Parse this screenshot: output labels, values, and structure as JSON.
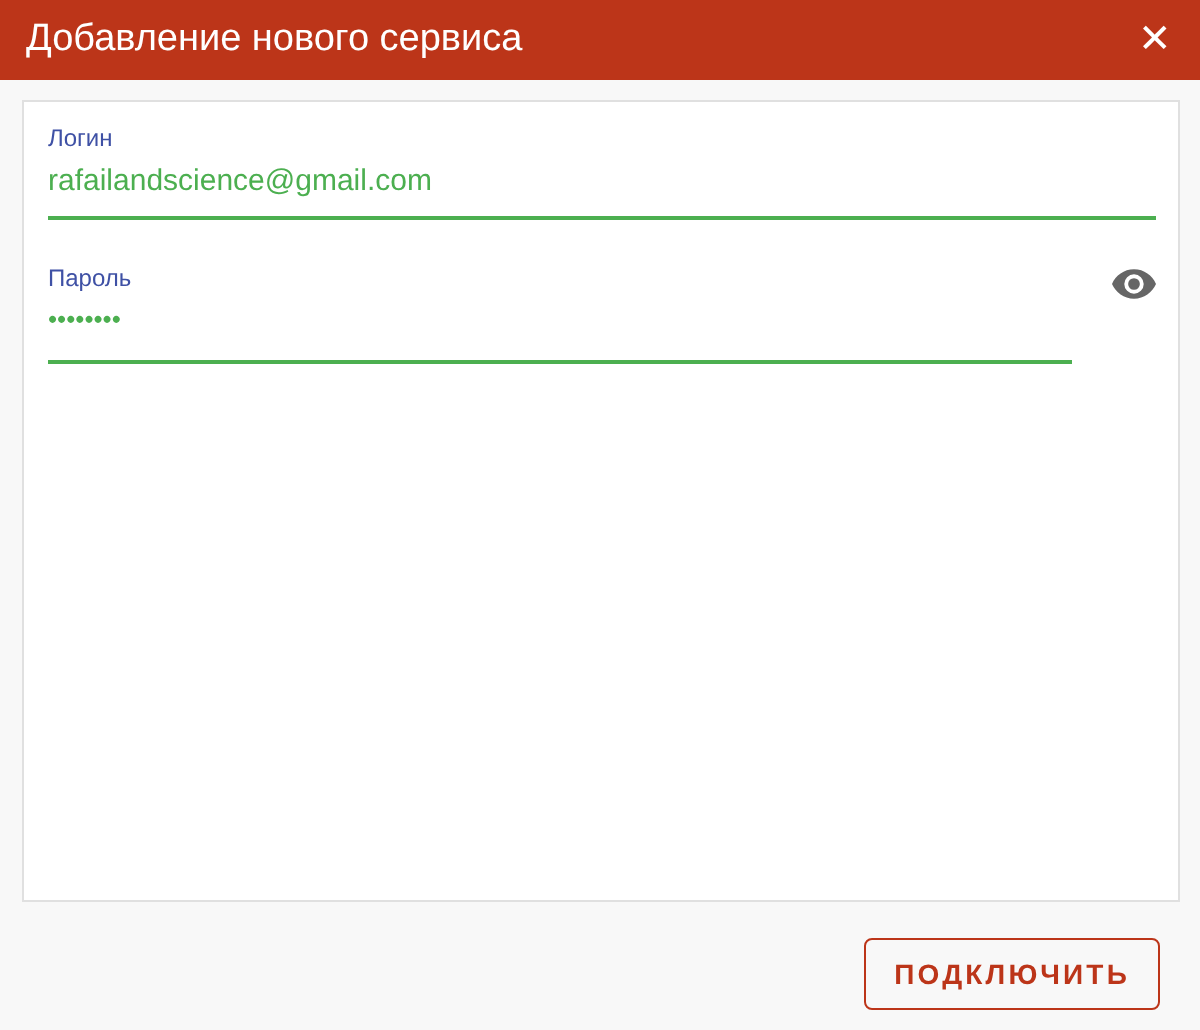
{
  "window": {
    "title": "Добавление нового сервиса",
    "close": "✕"
  },
  "fields": [
    {
      "label": "Логин",
      "value": "rafailandscience@gmail.com",
      "kind": "text"
    },
    {
      "label": "Пароль",
      "value": "••••••••",
      "kind": "password"
    }
  ],
  "buttons": [
    "ПОДКЛЮЧИТЬ"
  ]
}
